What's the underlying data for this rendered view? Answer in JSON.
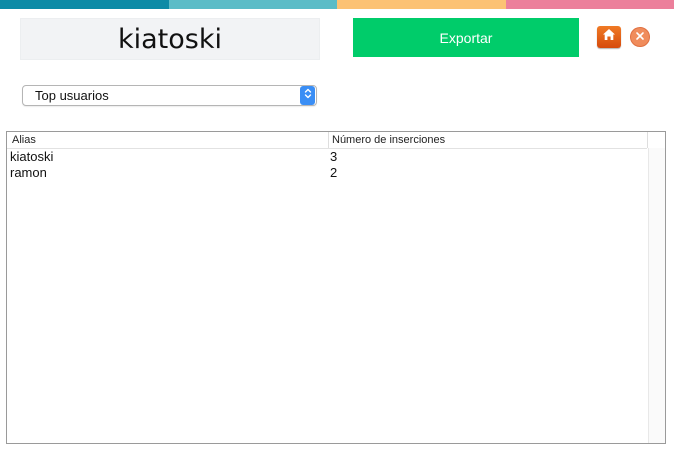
{
  "strip_colors": [
    "#0d8ba6",
    "#5bbcc7",
    "#fcc274",
    "#ec7f9b"
  ],
  "header": {
    "username": "kiatoski",
    "export_label": "Exportar",
    "export_color": "#00cc6a",
    "home_icon": "home-icon",
    "close_icon": "close-icon"
  },
  "report_select": {
    "selected": "Top usuarios",
    "stepper_color": "#3a8ef5"
  },
  "table": {
    "columns": [
      "Alias",
      "Número de inserciones"
    ],
    "rows": [
      {
        "alias": "kiatoski",
        "count": "3"
      },
      {
        "alias": "ramon",
        "count": "2"
      }
    ]
  }
}
